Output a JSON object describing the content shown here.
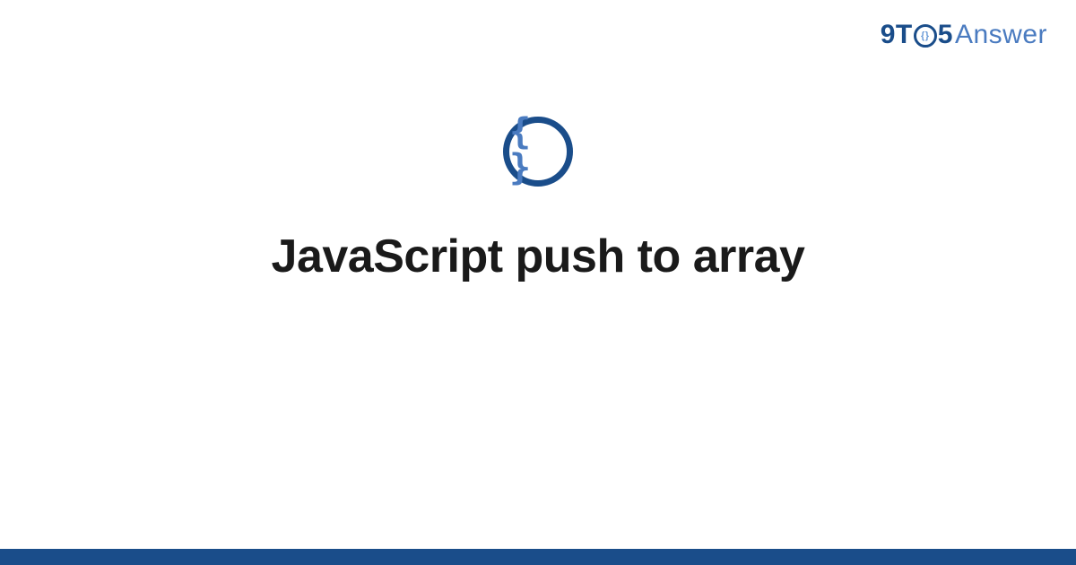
{
  "logo": {
    "part_9t": "9T",
    "part_o_inner": "{}",
    "part_5": "5",
    "part_answer": "Answer"
  },
  "topic_icon_glyph": "{ }",
  "title": "JavaScript push to array",
  "colors": {
    "brand_dark": "#1a4d8a",
    "brand_light": "#4a7bc0",
    "text": "#1a1a1a"
  }
}
